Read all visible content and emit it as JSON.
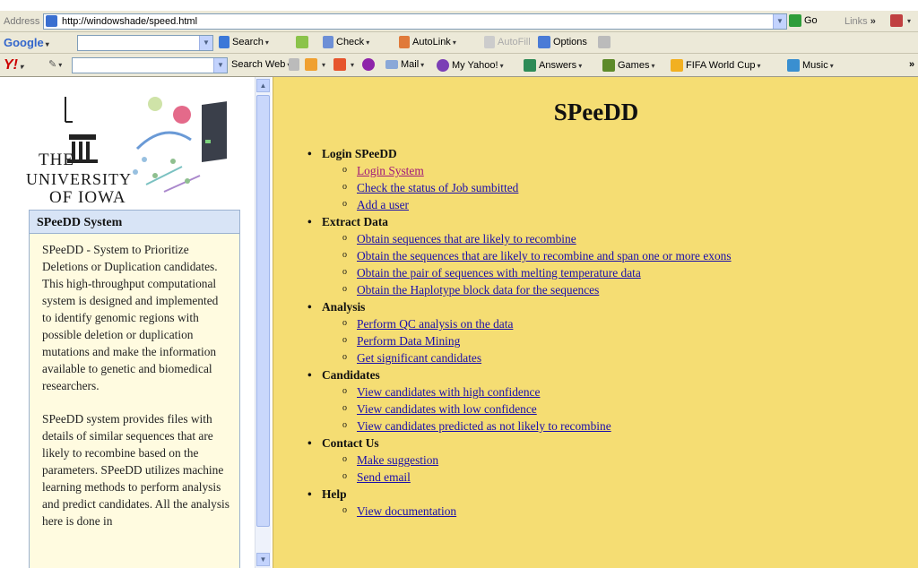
{
  "address_bar": {
    "label": "Address",
    "url": "http://windowshade/speed.html",
    "go_label": "Go",
    "links_label": "Links"
  },
  "google_bar": {
    "logo": "Google",
    "search_label": "Search",
    "check_label": "Check",
    "autolink_label": "AutoLink",
    "autofill_label": "AutoFill",
    "options_label": "Options"
  },
  "yahoo_bar": {
    "logo": "Y!",
    "search_web_label": "Search Web",
    "items": [
      "Mail",
      "My Yahoo!",
      "Answers",
      "Games",
      "FIFA World Cup",
      "Music"
    ],
    "overflow": "»"
  },
  "sidebar": {
    "logo": {
      "line1": "THE",
      "line2": "UNIVERSITY",
      "line3": "OF IOWA"
    },
    "panel_title": "SPeeDD System",
    "paragraphs": [
      "SPeeDD - System to Prioritize Deletions or Duplication candidates. This high-throughput computational system is designed and implemented to identify genomic regions with possible deletion or duplication mutations and make the information available to genetic and biomedical researchers.",
      "SPeeDD system provides files with details of similar sequences that are likely to recombine based on the parameters. SPeeDD utilizes machine learning methods to perform analysis and predict candidates. All the analysis here is done in"
    ]
  },
  "main": {
    "title": "SPeeDD",
    "sections": [
      {
        "label": "Login SPeeDD",
        "items": [
          "Login System",
          "Check the status of Job sumbitted",
          "Add a user"
        ]
      },
      {
        "label": "Extract Data",
        "items": [
          "Obtain sequences that are likely to recombine",
          "Obtain the sequences that are likely to recombine and span one or more exons",
          "Obtain the pair of sequences with melting temperature data",
          "Obtain the Haplotype block data for the sequences"
        ]
      },
      {
        "label": "Analysis",
        "items": [
          "Perform QC analysis on the data",
          "Perform Data Mining",
          "Get significant candidates"
        ]
      },
      {
        "label": "Candidates",
        "items": [
          "View candidates with high confidence",
          "View candidates with low confidence",
          "View candidates predicted as not likely to recombine"
        ]
      },
      {
        "label": "Contact Us",
        "items": [
          "Make suggestion",
          "Send email"
        ]
      },
      {
        "label": "Help",
        "items": [
          "View documentation"
        ]
      }
    ]
  },
  "colors": {
    "main_bg": "#f5dd73",
    "panel_bg": "#fffbe0",
    "panel_header_bg": "#d8e4f6",
    "link": "#1a0dab",
    "visited_link": "#a0187a"
  }
}
